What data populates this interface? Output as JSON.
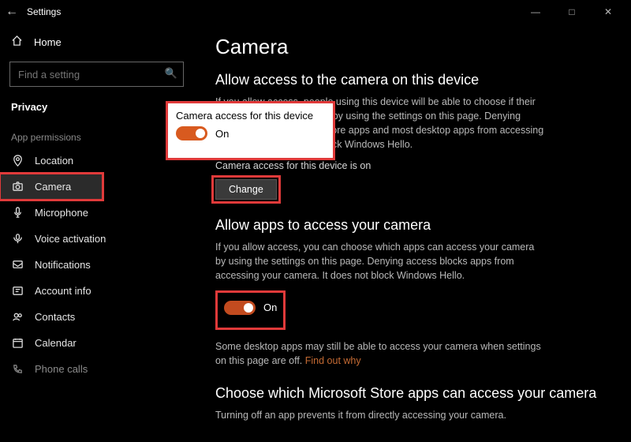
{
  "window": {
    "title": "Settings",
    "min": "—",
    "max": "□",
    "close": "✕"
  },
  "sidebar": {
    "home": "Home",
    "search_placeholder": "Find a setting",
    "category": "Privacy",
    "group": "App permissions",
    "items": [
      {
        "label": "Location"
      },
      {
        "label": "Camera"
      },
      {
        "label": "Microphone"
      },
      {
        "label": "Voice activation"
      },
      {
        "label": "Notifications"
      },
      {
        "label": "Account info"
      },
      {
        "label": "Contacts"
      },
      {
        "label": "Calendar"
      },
      {
        "label": "Phone calls"
      }
    ]
  },
  "page": {
    "title": "Camera",
    "s1": {
      "heading": "Allow access to the camera on this device",
      "body": "If you allow access, people using this device will be able to choose if their apps have camera access by using the settings on this page. Denying access blocks Microsoft Store apps and most desktop apps from accessing the camera. It does not block Windows Hello.",
      "status": "Camera access for this device is on",
      "button": "Change"
    },
    "s2": {
      "heading": "Allow apps to access your camera",
      "body": "If you allow access, you can choose which apps can access your camera by using the settings on this page. Denying access blocks apps from accessing your camera. It does not block Windows Hello.",
      "toggle_state": "On",
      "note_a": "Some desktop apps may still be able to access your camera when settings on this page are off. ",
      "note_link": "Find out why"
    },
    "s3": {
      "heading": "Choose which Microsoft Store apps can access your camera",
      "body": "Turning off an app prevents it from directly accessing your camera."
    }
  },
  "popup": {
    "title": "Camera access for this device",
    "state": "On"
  }
}
